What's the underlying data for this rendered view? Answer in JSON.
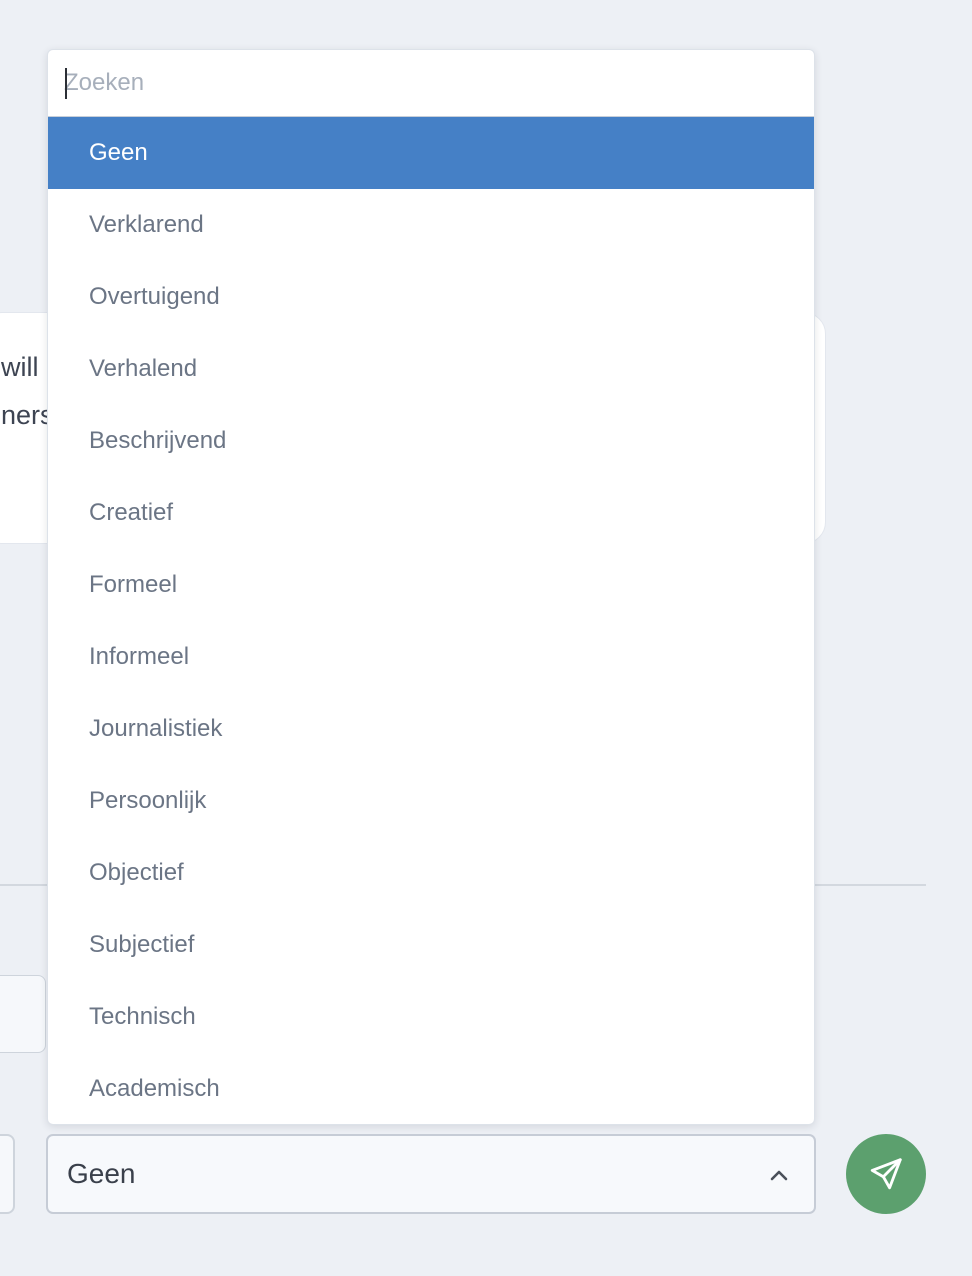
{
  "background_card": {
    "line1": "will",
    "line2": "ners"
  },
  "dropdown": {
    "search_placeholder": "Zoeken",
    "search_value": "",
    "options": [
      "Geen",
      "Verklarend",
      "Overtuigend",
      "Verhalend",
      "Beschrijvend",
      "Creatief",
      "Formeel",
      "Informeel",
      "Journalistiek",
      "Persoonlijk",
      "Objectief",
      "Subjectief",
      "Technisch",
      "Academisch"
    ],
    "selected_index": 0
  },
  "select": {
    "value": "Geen",
    "icon": "chevron-up-icon"
  },
  "send_button": {
    "icon": "send-icon",
    "color": "#5ca06e"
  },
  "colors": {
    "accent": "#4580c6",
    "background": "#edf0f5"
  }
}
